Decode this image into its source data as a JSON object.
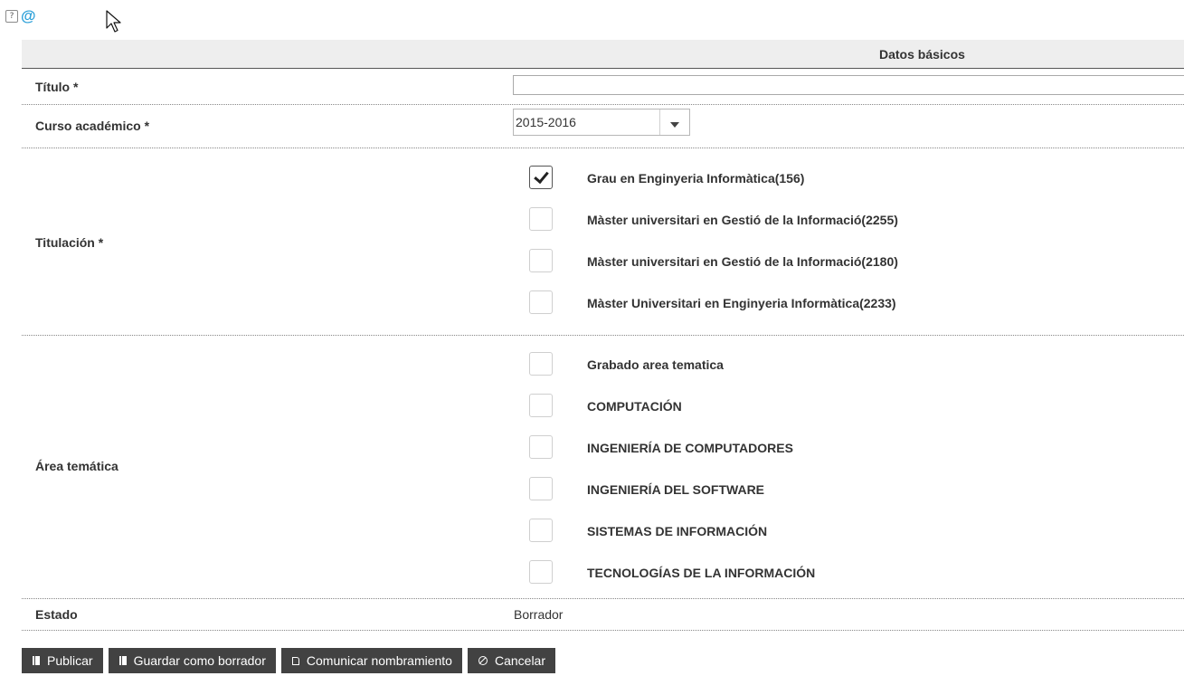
{
  "top_icons": {
    "help": "?",
    "at": "@"
  },
  "section": {
    "title": "Datos básicos"
  },
  "fields": {
    "titulo": {
      "label": "Título *",
      "value": ""
    },
    "curso": {
      "label": "Curso académico *",
      "value": "2015-2016"
    },
    "titulacion": {
      "label": "Titulación *",
      "options": [
        {
          "label": "Grau en Enginyeria Informàtica(156)",
          "checked": true
        },
        {
          "label": "Màster universitari en Gestió de la Informació(2255)",
          "checked": false
        },
        {
          "label": "Màster universitari en Gestió de la Informació(2180)",
          "checked": false
        },
        {
          "label": "Màster Universitari en Enginyeria Informàtica(2233)",
          "checked": false
        }
      ]
    },
    "area": {
      "label": "Área temática",
      "options": [
        {
          "label": "Grabado area tematica",
          "checked": false
        },
        {
          "label": "COMPUTACIÓN",
          "checked": false
        },
        {
          "label": "INGENIERÍA DE COMPUTADORES",
          "checked": false
        },
        {
          "label": "INGENIERÍA DEL SOFTWARE",
          "checked": false
        },
        {
          "label": "SISTEMAS DE INFORMACIÓN",
          "checked": false
        },
        {
          "label": "TECNOLOGÍAS DE LA INFORMACIÓN",
          "checked": false
        }
      ]
    },
    "estado": {
      "label": "Estado",
      "value": "Borrador"
    }
  },
  "buttons": {
    "publicar": "Publicar",
    "guardar": "Guardar como borrador",
    "comunicar": "Comunicar nombramiento",
    "cancelar": "Cancelar"
  }
}
